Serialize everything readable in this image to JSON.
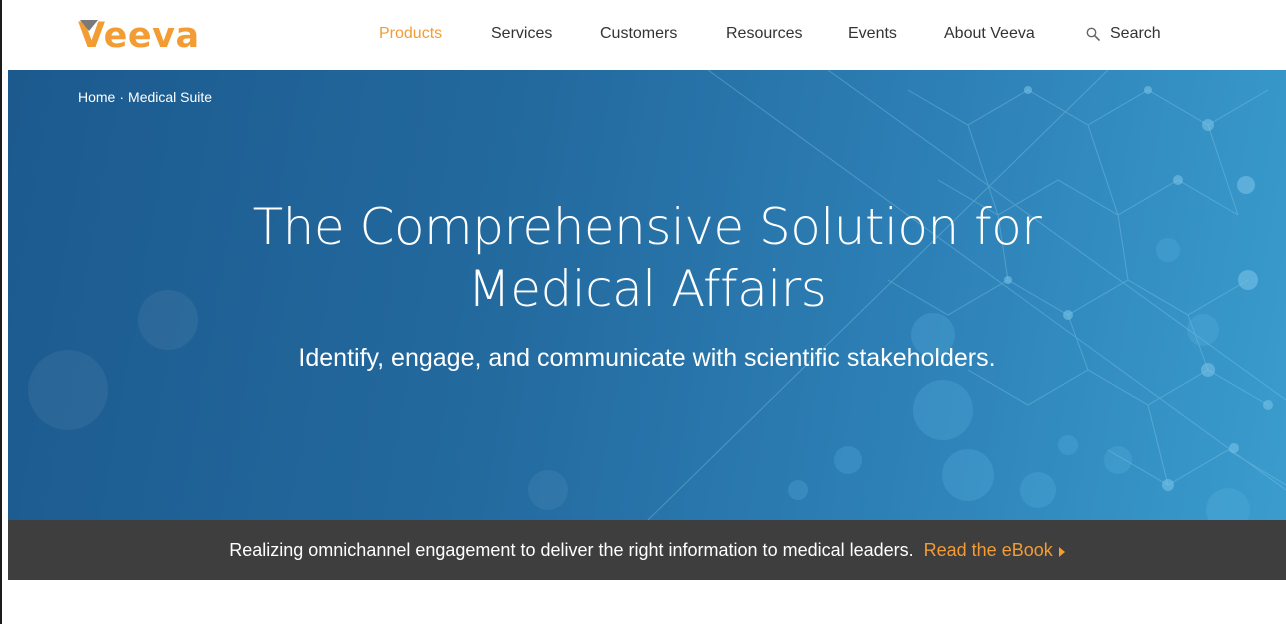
{
  "brand": {
    "logo_text": "Veeva",
    "accent_color": "#f39c34",
    "mark_color": "#7a7a7a"
  },
  "nav": {
    "items": [
      {
        "label": "Products",
        "active": true
      },
      {
        "label": "Services",
        "active": false
      },
      {
        "label": "Customers",
        "active": false
      },
      {
        "label": "Resources",
        "active": false
      },
      {
        "label": "Events",
        "active": false
      },
      {
        "label": "About Veeva",
        "active": false
      }
    ],
    "search_label": "Search",
    "search_icon": "search-icon"
  },
  "breadcrumb": {
    "home": "Home",
    "separator": "·",
    "current": "Medical Suite"
  },
  "hero": {
    "title_line1": "The Comprehensive Solution for",
    "title_line2": "Medical Affairs",
    "subtitle": "Identify, engage, and communicate with scientific stakeholders."
  },
  "promo": {
    "text": "Realizing omnichannel engagement to deliver the right information to medical leaders.",
    "link_label": "Read the eBook",
    "link_icon": "caret-right-icon"
  }
}
